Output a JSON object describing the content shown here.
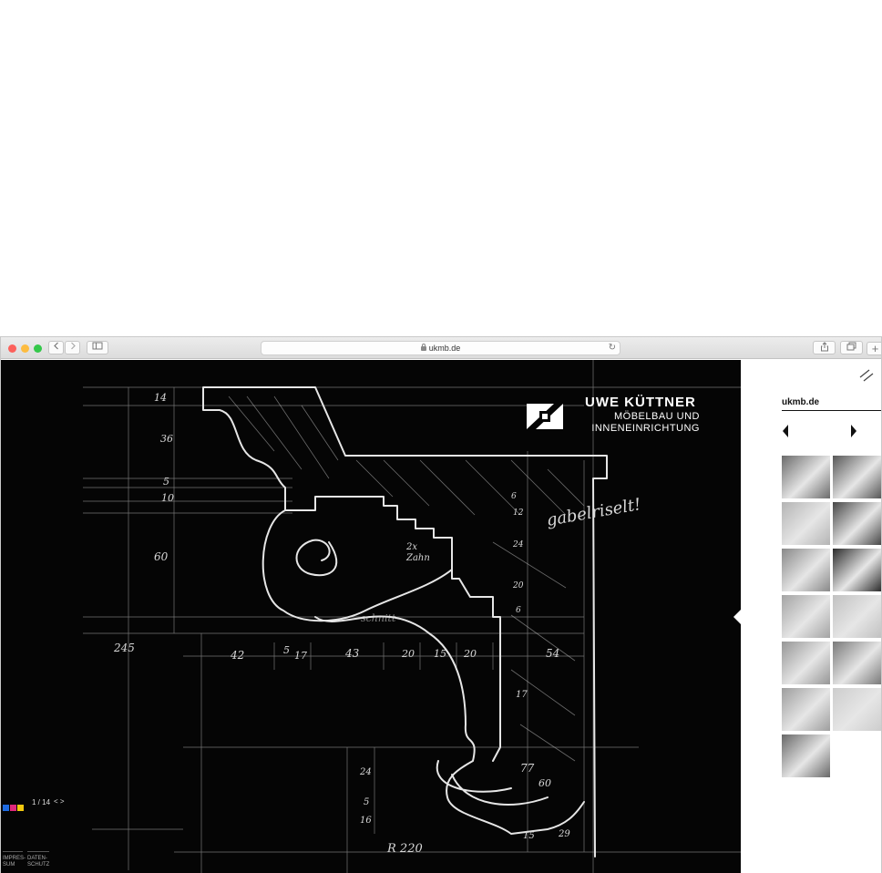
{
  "browser": {
    "url": "ukmb.de",
    "traffic_colors": [
      "#fc605b",
      "#fdbc40",
      "#34c84a"
    ]
  },
  "brand": {
    "name": "UWE KÜTTNER",
    "line1": "MÖBELBAU UND",
    "line2": "INNENEINRICHTUNG"
  },
  "gallery": {
    "counter": "1 / 14",
    "nav": "< >",
    "swatches": [
      "#1e6ae0",
      "#e0287c",
      "#f2c80f"
    ]
  },
  "footer": {
    "impressum_1": "IMPRES-",
    "impressum_2": "SUM",
    "datenschutz_1": "DATEN-",
    "datenschutz_2": "SCHUTZ"
  },
  "sketch_notes": {
    "text_gabel": "gabelriselt!",
    "text_zahn_1": "2x",
    "text_zahn_2": "Zahn",
    "text_schnitt": "schnitt",
    "text_radius": "R 220",
    "dims": [
      "14",
      "36",
      "5",
      "10",
      "60",
      "245",
      "42",
      "5",
      "17",
      "43",
      "20",
      "15",
      "20",
      "54",
      "6",
      "12",
      "24",
      "20",
      "6",
      "17",
      "77",
      "60",
      "15",
      "29",
      "24",
      "5",
      "16"
    ]
  },
  "panel": {
    "title": "ukmb.de",
    "menu_icon": "double-slash-icon",
    "thumbs": [
      {
        "name": "thumb-1",
        "tone": "#6f6a62"
      },
      {
        "name": "thumb-2",
        "tone": "#5b5650"
      },
      {
        "name": "thumb-3",
        "tone": "#b9b4ab"
      },
      {
        "name": "thumb-4",
        "tone": "#4a4642"
      },
      {
        "name": "thumb-5",
        "tone": "#8d8881"
      },
      {
        "name": "thumb-6",
        "tone": "#2d2b29"
      },
      {
        "name": "thumb-7",
        "tone": "#a8a39b"
      },
      {
        "name": "thumb-8",
        "tone": "#c5c1b9"
      },
      {
        "name": "thumb-9",
        "tone": "#9a958e"
      },
      {
        "name": "thumb-10",
        "tone": "#7e7972"
      },
      {
        "name": "thumb-11",
        "tone": "#a29d96"
      },
      {
        "name": "thumb-12",
        "tone": "#d1cdc6"
      },
      {
        "name": "thumb-13",
        "tone": "#6b6762"
      }
    ]
  }
}
